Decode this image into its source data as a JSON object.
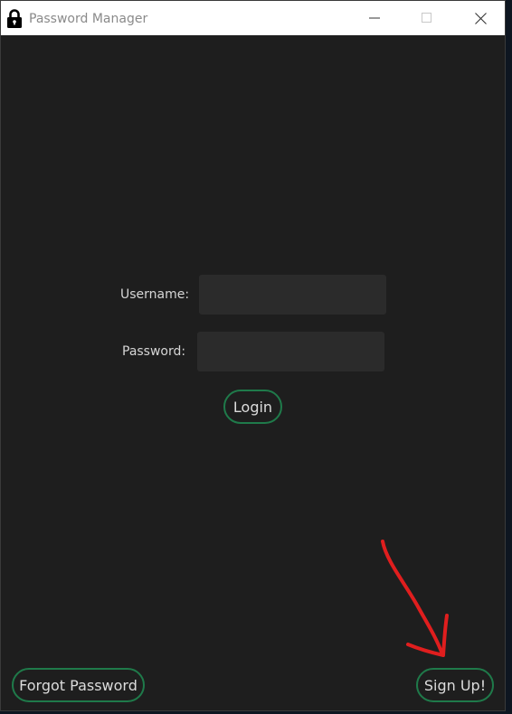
{
  "window": {
    "title": "Password Manager",
    "icon": "lock-icon"
  },
  "window_controls": {
    "minimize": "minimize-icon",
    "maximize": "maximize-icon",
    "close": "close-icon"
  },
  "form": {
    "username_label": "Username:",
    "username_value": "",
    "password_label": "Password:",
    "password_value": "",
    "login_label": "Login"
  },
  "footer": {
    "forgot_password_label": "Forgot Password",
    "sign_up_label": "Sign Up!"
  },
  "colors": {
    "background": "#1e1e1e",
    "titlebar": "#ffffff",
    "field_background": "#2b2b2b",
    "button_border": "#1f7a4a",
    "annotation": "#e01e1e"
  },
  "annotation": {
    "shape": "hand-drawn-arrow",
    "points_to": "sign-up-button"
  }
}
